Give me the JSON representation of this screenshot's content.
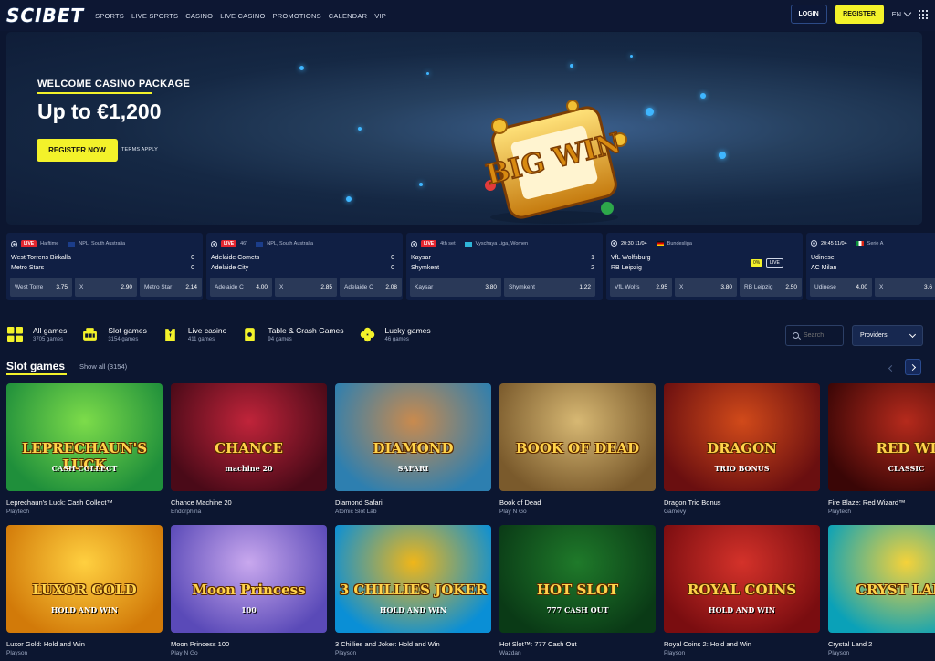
{
  "brand": {
    "logo": "SCIBET",
    "accent": "#f3f22a",
    "bg": "#0c1630"
  },
  "nav": [
    "SPORTS",
    "LIVE SPORTS",
    "CASINO",
    "LIVE CASINO",
    "PROMOTIONS",
    "CALENDAR",
    "VIP"
  ],
  "auth": {
    "login": "LOGIN",
    "register": "REGISTER",
    "language": "EN"
  },
  "banner": {
    "kicker": "WELCOME CASINO PACKAGE",
    "title": "Up to €1,200",
    "cta": "REGISTER NOW",
    "terms": "TERMS APPLY",
    "art_text": "BIG WIN"
  },
  "events": [
    {
      "status": "LIVE",
      "period": "Halftime",
      "league": "NPL, South Australia",
      "team1": "West Torrens Birkalla",
      "team2": "Metro Stars",
      "score1": "0",
      "score2": "0",
      "odds": [
        {
          "label": "West Torre",
          "value": "3.75"
        },
        {
          "label": "X",
          "value": "2.90"
        },
        {
          "label": "Metro Star",
          "value": "2.14"
        }
      ]
    },
    {
      "status": "LIVE",
      "period": "46'",
      "league": "NPL, South Australia",
      "team1": "Adelaide Comets",
      "team2": "Adelaide City",
      "score1": "0",
      "score2": "0",
      "odds": [
        {
          "label": "Adelaide C",
          "value": "4.00"
        },
        {
          "label": "X",
          "value": "2.85"
        },
        {
          "label": "Adelaide C",
          "value": "2.08"
        }
      ]
    },
    {
      "status": "LIVE",
      "period": "4th set",
      "league": "Vyschaya Liga, Women",
      "team1": "Kaysar",
      "team2": "Shymkent",
      "score1": "1",
      "score2": "2",
      "odds": [
        {
          "label": "Kaysar",
          "value": "3.80"
        },
        {
          "label": "Shymkent",
          "value": "1.22"
        }
      ]
    },
    {
      "status": "",
      "period": "20:30  11/04",
      "league": "Bundesliga",
      "team1": "VfL Wolfsburg",
      "team2": "RB Leipzig",
      "score1": "",
      "score2": "",
      "badge_pct": "0%",
      "badge_live": "LIVE",
      "odds": [
        {
          "label": "VfL Wolfs",
          "value": "2.95"
        },
        {
          "label": "X",
          "value": "3.80"
        },
        {
          "label": "RB Leipzig",
          "value": "2.50"
        }
      ]
    },
    {
      "status": "",
      "period": "20:45  11/04",
      "league": "Serie A",
      "team1": "Udinese",
      "team2": "AC Milan",
      "score1": "",
      "score2": "",
      "odds": [
        {
          "label": "Udinese",
          "value": "4.00"
        },
        {
          "label": "X",
          "value": "3.6"
        }
      ]
    }
  ],
  "categories": [
    {
      "title": "All games",
      "count": "3705 games",
      "icon": "grid-icon"
    },
    {
      "title": "Slot games",
      "count": "3154 games",
      "icon": "slot-machine-icon"
    },
    {
      "title": "Live casino",
      "count": "411 games",
      "icon": "dealer-icon"
    },
    {
      "title": "Table & Crash Games",
      "count": "94 games",
      "icon": "cards-icon"
    },
    {
      "title": "Lucky games",
      "count": "46 games",
      "icon": "clover-icon"
    }
  ],
  "search": {
    "placeholder": "Search"
  },
  "providers": {
    "label": "Providers"
  },
  "section": {
    "title": "Slot games",
    "show_all": "Show all (3154)"
  },
  "games": [
    {
      "name": "Leprechaun's Luck: Cash Collect™",
      "provider": "Playtech",
      "art": "LEPRECHAUN'S LUCK",
      "art2": "CASH COLLECT",
      "c1": "#1f8f3b",
      "c2": "#7ddc4a"
    },
    {
      "name": "Chance Machine 20",
      "provider": "Endorphina",
      "art": "CHANCE",
      "art2": "machine 20",
      "c1": "#4a0a18",
      "c2": "#c0243a"
    },
    {
      "name": "Diamond Safari",
      "provider": "Atomic Slot Lab",
      "art": "DIAMOND",
      "art2": "SAFARI",
      "c1": "#2d7fb0",
      "c2": "#c98a4e"
    },
    {
      "name": "Book of Dead",
      "provider": "Play N Go",
      "art": "BOOK OF DEAD",
      "art2": "",
      "c1": "#7a5a2c",
      "c2": "#d7b873"
    },
    {
      "name": "Dragon Trio Bonus",
      "provider": "Gamevy",
      "art": "DRAGON",
      "art2": "TRIO BONUS",
      "c1": "#6a0f10",
      "c2": "#d14a1a"
    },
    {
      "name": "Fire Blaze: Red Wizard™",
      "provider": "Playtech",
      "art": "RED WI",
      "art2": "CLASSIC",
      "c1": "#3a0606",
      "c2": "#b52a1c"
    },
    {
      "name": "Luxor Gold: Hold and Win",
      "provider": "Playson",
      "art": "LUXOR GOLD",
      "art2": "HOLD AND WIN",
      "c1": "#d27a09",
      "c2": "#ffd040"
    },
    {
      "name": "Moon Princess 100",
      "provider": "Play N Go",
      "art": "Moon Princess",
      "art2": "100",
      "c1": "#5a4ab8",
      "c2": "#c9a8ee"
    },
    {
      "name": "3 Chillies and Joker: Hold and Win",
      "provider": "Playson",
      "art": "3 CHILLIES JOKER",
      "art2": "HOLD AND WIN",
      "c1": "#0a8fd6",
      "c2": "#f0b619"
    },
    {
      "name": "Hot Slot™: 777 Cash Out",
      "provider": "Wazdan",
      "art": "HOT SLOT",
      "art2": "777 CASH OUT",
      "c1": "#0a3a16",
      "c2": "#1f7a2a"
    },
    {
      "name": "Royal Coins 2: Hold and Win",
      "provider": "Playson",
      "art": "ROYAL COINS",
      "art2": "HOLD AND WIN",
      "c1": "#7a0d10",
      "c2": "#d4322a"
    },
    {
      "name": "Crystal Land 2",
      "provider": "Playson",
      "art": "CRYST LAND",
      "art2": "",
      "c1": "#0aa1b8",
      "c2": "#f5d23a"
    }
  ]
}
